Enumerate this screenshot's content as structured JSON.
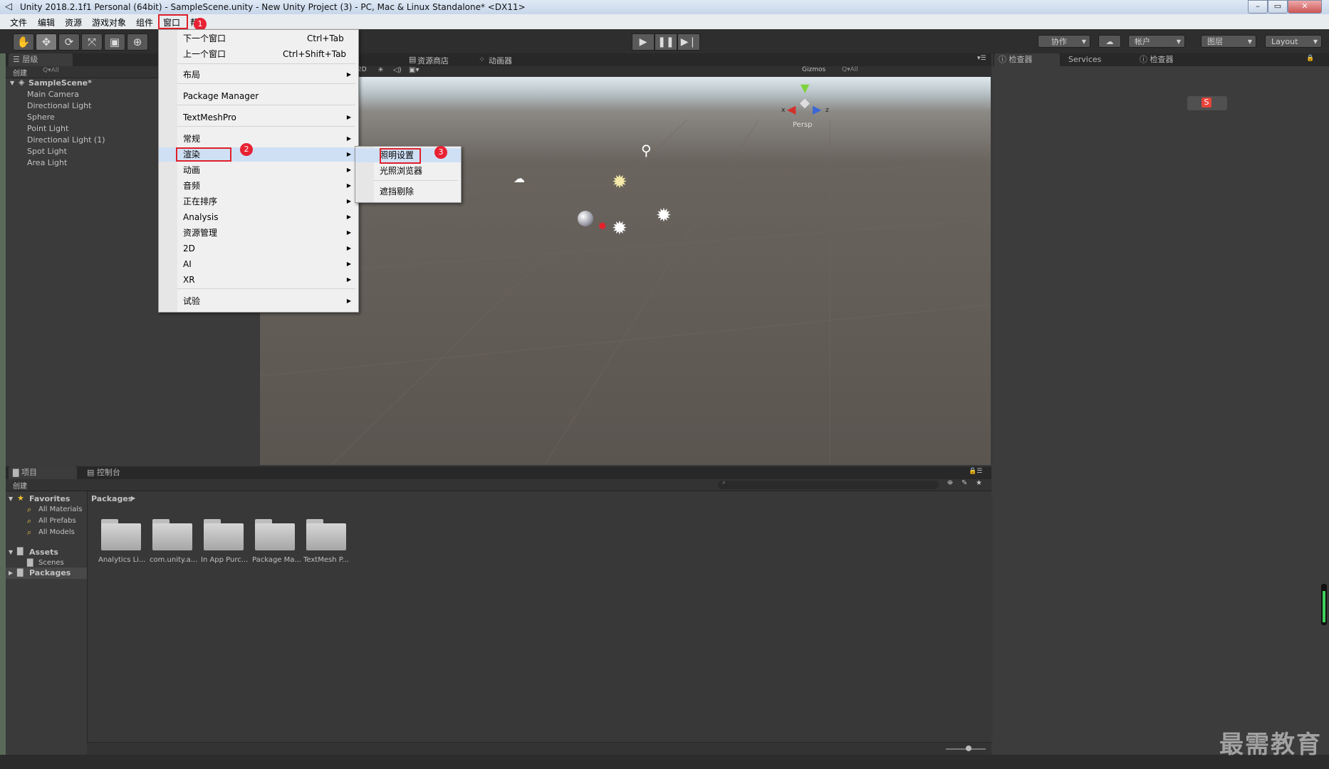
{
  "window": {
    "title": "Unity 2018.2.1f1 Personal (64bit) - SampleScene.unity - New Unity Project (3) - PC, Mac & Linux Standalone* <DX11>"
  },
  "menubar": [
    "文件",
    "编辑",
    "资源",
    "游戏对象",
    "组件",
    "窗口",
    "帮"
  ],
  "toolbar": {
    "collab": "协作",
    "account": "帐户",
    "layers": "图层",
    "layout": "Layout"
  },
  "hierarchy": {
    "tab": "层级",
    "create": "创建",
    "search": "Q▾All",
    "scene": "SampleScene*",
    "items": [
      "Main Camera",
      "Directional Light",
      "Sphere",
      "Point Light",
      "Directional Light (1)",
      "Spot Light",
      "Area Light"
    ]
  },
  "scene_tabs": {
    "store": "资源商店",
    "animator": "动画器",
    "gizmos": "Gizmos",
    "search": "Q▾All",
    "persp": "Persp",
    "mode": "2D"
  },
  "inspector_tabs": [
    "检查器",
    "Services",
    "检查器"
  ],
  "window_menu": {
    "items": [
      {
        "label": "下一个窗口",
        "shortcut": "Ctrl+Tab"
      },
      {
        "label": "上一个窗口",
        "shortcut": "Ctrl+Shift+Tab"
      },
      {
        "label": "布局"
      },
      {
        "label": "Package Manager"
      },
      {
        "label": "TextMeshPro"
      },
      {
        "label": "常规"
      },
      {
        "label": "渲染"
      },
      {
        "label": "动画"
      },
      {
        "label": "音频"
      },
      {
        "label": "正在排序"
      },
      {
        "label": "Analysis"
      },
      {
        "label": "资源管理"
      },
      {
        "label": "2D"
      },
      {
        "label": "AI"
      },
      {
        "label": "XR"
      },
      {
        "label": "试验"
      }
    ]
  },
  "render_submenu": {
    "items": [
      "照明设置",
      "光照浏览器",
      "遮挡剔除"
    ]
  },
  "badges": [
    "1",
    "2",
    "3"
  ],
  "project": {
    "tabs": [
      "项目",
      "控制台"
    ],
    "create": "创建",
    "favorites": "Favorites",
    "fav_items": [
      "All Materials",
      "All Prefabs",
      "All Models"
    ],
    "assets": "Assets",
    "scenes": "Scenes",
    "packages": "Packages",
    "breadcrumb": "Packages",
    "folders": [
      "Analytics Li...",
      "com.unity.a...",
      "In App Purc...",
      "Package Ma...",
      "TextMesh P..."
    ]
  },
  "watermark": "最需教育",
  "colors": {
    "highlight": "#e0202a",
    "menu_bg": "#f0f0f0",
    "editor_bg": "#3a3a3a"
  }
}
